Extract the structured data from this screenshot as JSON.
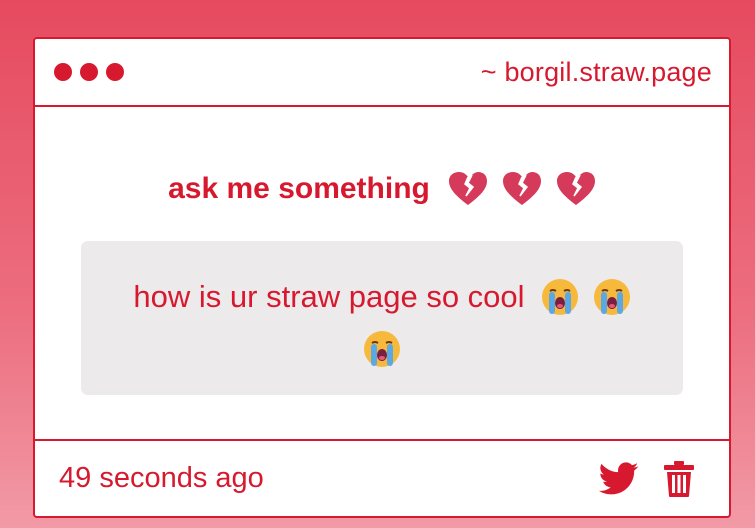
{
  "window": {
    "url": "~ borgil.straw.page"
  },
  "ask": {
    "prompt": "ask me something",
    "prompt_icons": [
      "broken-heart-icon",
      "broken-heart-icon",
      "broken-heart-icon"
    ]
  },
  "question": {
    "text": "how is ur straw page so cool",
    "emojis": [
      "loudly-crying-face-icon",
      "loudly-crying-face-icon",
      "loudly-crying-face-icon"
    ]
  },
  "footer": {
    "timestamp": "49 seconds ago",
    "icons": [
      "twitter-bird-icon",
      "trash-icon"
    ]
  },
  "colors": {
    "accent": "#d7192f",
    "background_top": "#e64a5f",
    "background_bottom": "#f29aa6",
    "question_bg": "#eceaeb"
  }
}
